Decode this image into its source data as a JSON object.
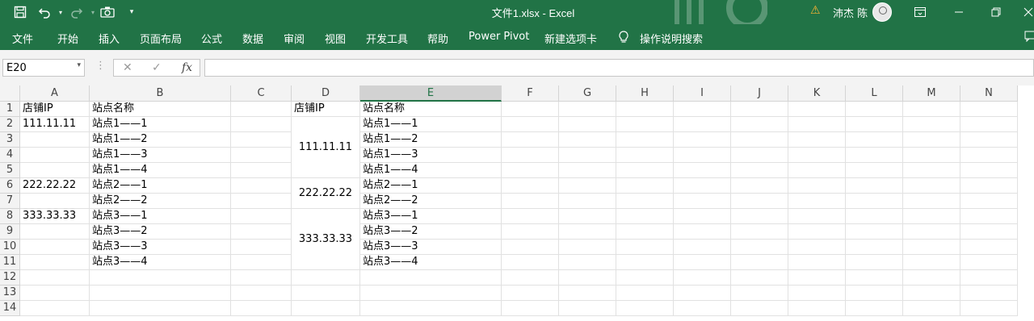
{
  "window": {
    "title": "文件1.xlsx  -  Excel",
    "user": "沛杰 陈"
  },
  "menu": [
    "文件",
    "开始",
    "插入",
    "页面布局",
    "公式",
    "数据",
    "审阅",
    "视图",
    "开发工具",
    "帮助",
    "Power Pivot",
    "新建选项卡",
    "操作说明搜索"
  ],
  "name_box": "E20",
  "formula_label": "fx",
  "columns": [
    "A",
    "B",
    "C",
    "D",
    "E",
    "F",
    "G",
    "H",
    "I",
    "J",
    "K",
    "L",
    "M",
    "N"
  ],
  "rows": [
    "1",
    "2",
    "3",
    "4",
    "5",
    "6",
    "7",
    "8",
    "9",
    "10",
    "11",
    "12",
    "13",
    "14"
  ],
  "cells": {
    "A1": "店铺IP",
    "B1": "站点名称",
    "D1": "店铺IP",
    "E1": "站点名称",
    "A2": "111.11.11",
    "A6": "222.22.22",
    "A8": "333.33.33",
    "B2": "站点1——1",
    "B3": "站点1——2",
    "B4": "站点1——3",
    "B5": "站点1——4",
    "B6": "站点2——1",
    "B7": "站点2——2",
    "B8": "站点3——1",
    "B9": "站点3——2",
    "B10": "站点3——3",
    "B11": "站点3——4",
    "E2": "站点1——1",
    "E3": "站点1——2",
    "E4": "站点1——3",
    "E5": "站点1——4",
    "E6": "站点2——1",
    "E7": "站点2——2",
    "E8": "站点3——1",
    "E9": "站点3——2",
    "E10": "站点3——3",
    "E11": "站点3——4"
  },
  "merged": {
    "D2:D5": "111.11.11",
    "D6:D7": "222.22.22",
    "D8:D11": "333.33.33"
  },
  "icons": [
    "save-icon",
    "undo-icon",
    "redo-icon",
    "camera-icon",
    "customize-icon",
    "warning-icon",
    "ribbon-display-icon",
    "minimize-icon",
    "restore-icon",
    "lightbulb-icon"
  ],
  "colors": {
    "excel_green": "#217346",
    "header_gray": "#f3f3f3",
    "grid_line": "#e1e1e1"
  }
}
